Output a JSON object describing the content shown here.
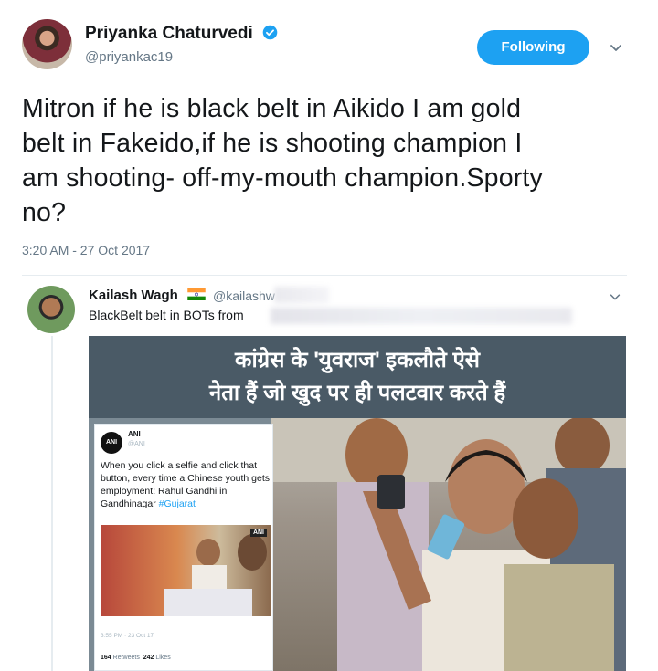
{
  "author": {
    "display_name": "Priyanka Chaturvedi",
    "handle": "@priyankac19",
    "verified": true
  },
  "follow_button": {
    "label": "Following"
  },
  "tweet": {
    "text": "Mitron if he is black belt in Aikido I am gold\nbelt in Fakeido,if he is shooting champion I\nam shooting- off-my-mouth champion.Sporty\nno?",
    "timestamp": "3:20 AM - 27 Oct 2017"
  },
  "quoted": {
    "display_name": "Kailash Wagh",
    "handle": "@kailashw",
    "text": "BlackBelt belt in BOTs from",
    "media": {
      "banner_text": "कांग्रेस के 'युवराज' इकलौते ऐसे\nनेता हैं जो खुद पर ही पलटवार करते हैं",
      "embedded_tweet": {
        "name": "ANI",
        "handle": "@ANI",
        "text_main": "When you click a selfie and click that button, every time a Chinese youth gets employment: Rahul Gandhi in Gandhinagar ",
        "hashtag": "#Gujarat",
        "image_badge": "ANI",
        "time": "3:55 PM · 23 Oct 17",
        "retweets_count": "164",
        "retweets_label": "Retweets",
        "likes_count": "242",
        "likes_label": "Likes"
      }
    }
  },
  "colors": {
    "accent": "#1da1f2",
    "text_primary": "#14171a",
    "text_secondary": "#657786",
    "banner_bg": "#4a5a66"
  },
  "icons": [
    "verified-badge-icon",
    "chevron-down-icon",
    "india-flag-icon"
  ]
}
